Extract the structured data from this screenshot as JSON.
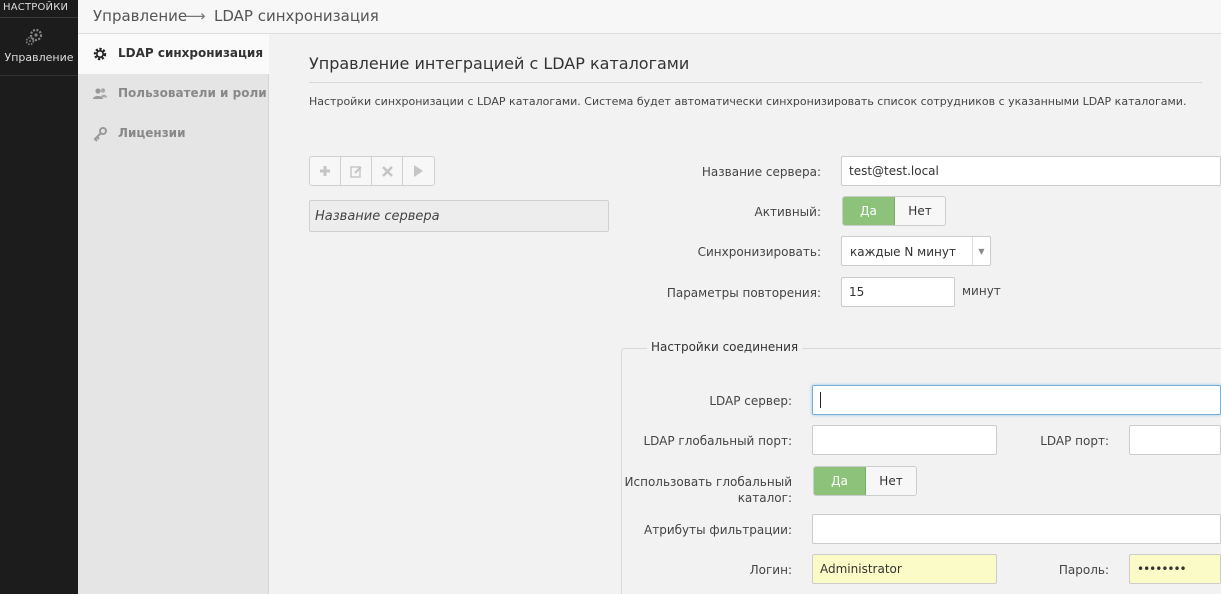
{
  "rail": {
    "header": "НАСТРОЙКИ",
    "item_label": "Управление"
  },
  "breadcrumb": {
    "items": [
      "Управление",
      "LDAP синхронизация"
    ],
    "separator": "⟶"
  },
  "subnav": {
    "items": [
      {
        "label": "LDAP синхронизация",
        "icon": "gear-icon",
        "active": true
      },
      {
        "label": "Пользователи и роли",
        "icon": "users-icon",
        "active": false
      },
      {
        "label": "Лицензии",
        "icon": "key-icon",
        "active": false
      }
    ]
  },
  "main": {
    "title": "Управление интеграцией с LDAP каталогами",
    "description": "Настройки синхронизации с LDAP каталогами. Система будет автоматически синхронизировать список сотрудников с указанными LDAP каталогами.",
    "server_list_placeholder": "Название сервера"
  },
  "form": {
    "server_name_label": "Название сервера:",
    "server_name_value": "test@test.local",
    "active_label": "Активный:",
    "yes": "Да",
    "no": "Нет",
    "sync_label": "Синхронизировать:",
    "sync_value": "каждые N минут",
    "repeat_label": "Параметры повторения:",
    "repeat_value": "15",
    "repeat_unit": "минут"
  },
  "connection": {
    "legend": "Настройки соединения",
    "ldap_server_label": "LDAP сервер:",
    "ldap_server_value": "",
    "global_port_label": "LDAP глобальный порт:",
    "global_port_value": "",
    "ldap_port_label": "LDAP порт:",
    "ldap_port_value": "",
    "use_global_label_1": "Использовать глобальный",
    "use_global_label_2": "каталог:",
    "filter_label": "Атрибуты фильтрации:",
    "filter_value": "",
    "login_label": "Логин:",
    "login_value": "Administrator",
    "password_label": "Пароль:",
    "password_value": "••••••••"
  },
  "colors": {
    "rail": "#1c1c1c",
    "toggle_on": "#8cc27a",
    "autofill": "#fbfbc8"
  }
}
